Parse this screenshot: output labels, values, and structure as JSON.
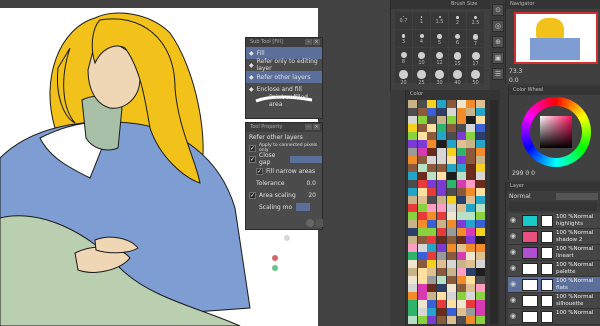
{
  "subtool": {
    "title": "Sub Tool [Fill]",
    "items": [
      {
        "label": "Fill"
      },
      {
        "label": "Refer only to editing layer"
      },
      {
        "label": "Refer other layers"
      },
      {
        "label": "Enclose and fill"
      },
      {
        "label": "Paint unfilled area"
      }
    ]
  },
  "toolprop": {
    "title": "Tool Property",
    "header": "Refer other layers",
    "apply_connected": "Apply to connected pixels only",
    "close_gap": "Close gap",
    "fill_narrow": "Fill narrow areas",
    "tolerance_label": "Tolerance",
    "tolerance_value": "0.0",
    "area_scaling_label": "Area scaling",
    "area_scaling_value": "20",
    "scaling_mode_label": "Scaling mo"
  },
  "brush_size": {
    "title": "Brush Size",
    "values": [
      "0.7",
      "1",
      "1.5",
      "2",
      "2.5",
      "3",
      "4",
      "5",
      "6",
      "7",
      "8",
      "10",
      "12",
      "15",
      "17",
      "20",
      "25",
      "30",
      "40",
      "50"
    ]
  },
  "navigator": {
    "title": "Navigator",
    "zoom": "73.3",
    "angle": "0.0"
  },
  "color_wheel": {
    "title": "Color Wheel",
    "rgb_readout": "299 0 0",
    "accent_hue": "#ff1060"
  },
  "color_set": {
    "title": "Color"
  },
  "layer_panel": {
    "title": "Layer",
    "blend_mode": "Normal",
    "opacity": "100",
    "layers": [
      {
        "line1": "100 %Normal",
        "line2": "highlights",
        "color": "#19c9c9",
        "active": false
      },
      {
        "line1": "100 %Normal",
        "line2": "shadow 2",
        "color": "#e85080",
        "active": false
      },
      {
        "line1": "100 %Normal",
        "line2": "lineart",
        "color": "#b050d0",
        "active": false
      },
      {
        "line1": "100 %Normal",
        "line2": "palette",
        "color": "#ffffff",
        "active": false
      },
      {
        "line1": "100 %Normal",
        "line2": "flats",
        "color": "#ffffff",
        "active": true
      },
      {
        "line1": "100 %Normal",
        "line2": "silhouette",
        "color": "#ffffff",
        "active": false
      },
      {
        "line1": "100 %Normal",
        "line2": "",
        "color": "#ffffff",
        "active": false
      }
    ]
  },
  "colors": {
    "panel_bg": "#404040",
    "selection_blue": "#5c6f9a",
    "hair_yellow": "#f2c21b",
    "coat_blue": "#7e9ed3",
    "skin": "#efd6b4",
    "blanket_green": "#b9cfb0"
  }
}
